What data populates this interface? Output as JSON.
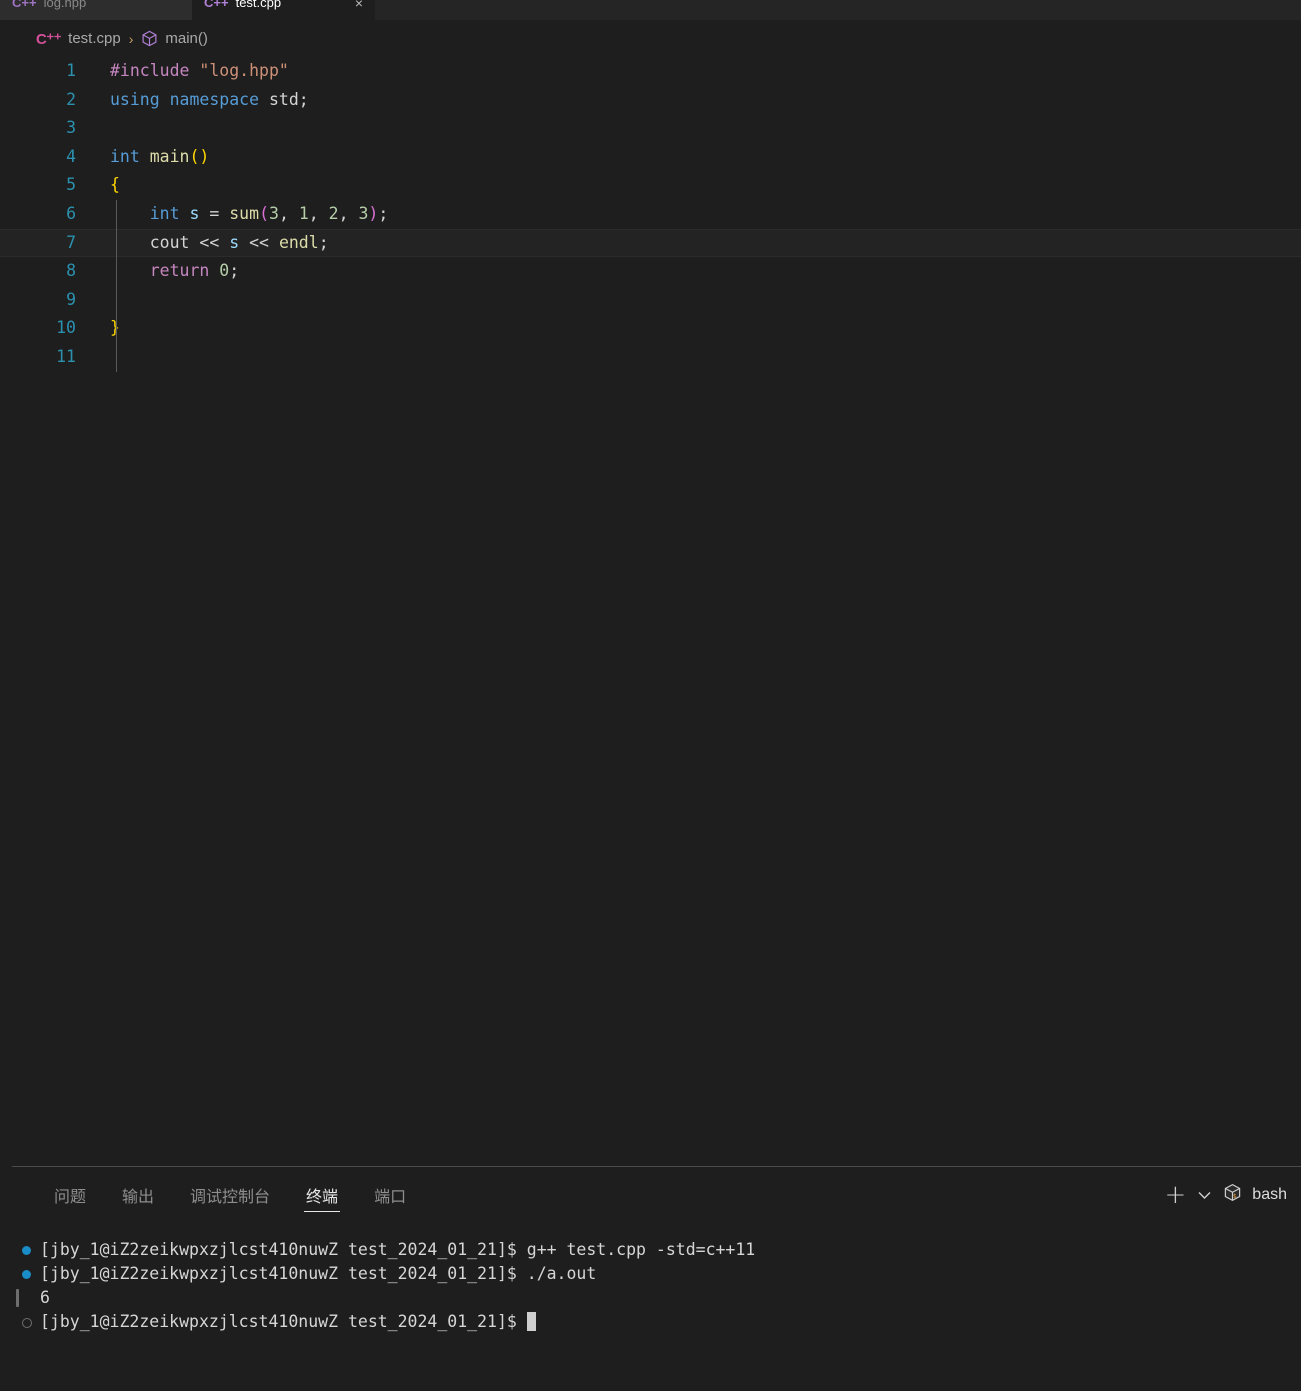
{
  "window": {
    "editor_background": "#1e1e1e",
    "tabbar_background": "#252526"
  },
  "tabbar": {
    "tabs": [
      {
        "label": "log.hpp",
        "icon": "cpp-header-file-icon",
        "icon_char": "C++",
        "active": false,
        "dirty": false
      },
      {
        "label": "test.cpp",
        "icon": "cpp-source-file-icon",
        "icon_char": "C++",
        "active": true,
        "close_char": "×"
      }
    ]
  },
  "breadcrumb": {
    "file_icon": "C⁺⁺",
    "file": "test.cpp",
    "separator": "›",
    "symbol_icon": "cube-icon",
    "symbol": "main()"
  },
  "editor": {
    "language": "cpp",
    "current_line": 7,
    "total_lines": 11,
    "lines": [
      {
        "n": "1",
        "tokens": [
          {
            "t": "#include ",
            "c": "t-pre"
          },
          {
            "t": "\"log.hpp\"",
            "c": "t-str"
          }
        ]
      },
      {
        "n": "2",
        "tokens": [
          {
            "t": "using",
            "c": "t-kw"
          },
          {
            "t": " ",
            "c": "t-plain"
          },
          {
            "t": "namespace",
            "c": "t-kw"
          },
          {
            "t": " ",
            "c": "t-plain"
          },
          {
            "t": "std",
            "c": "t-plain"
          },
          {
            "t": ";",
            "c": "t-plain"
          }
        ]
      },
      {
        "n": "3",
        "tokens": []
      },
      {
        "n": "4",
        "tokens": [
          {
            "t": "int",
            "c": "t-kw"
          },
          {
            "t": " ",
            "c": "t-plain"
          },
          {
            "t": "main",
            "c": "t-fn"
          },
          {
            "t": "()",
            "c": "t-brace"
          }
        ]
      },
      {
        "n": "5",
        "tokens": [
          {
            "t": "{",
            "c": "t-brace"
          }
        ]
      },
      {
        "n": "6",
        "tokens": [
          {
            "t": "    ",
            "c": "t-plain"
          },
          {
            "t": "int",
            "c": "t-kw"
          },
          {
            "t": " ",
            "c": "t-plain"
          },
          {
            "t": "s",
            "c": "t-var"
          },
          {
            "t": " = ",
            "c": "t-plain"
          },
          {
            "t": "sum",
            "c": "t-fn"
          },
          {
            "t": "(",
            "c": "t-paren"
          },
          {
            "t": "3",
            "c": "t-num"
          },
          {
            "t": ", ",
            "c": "t-plain"
          },
          {
            "t": "1",
            "c": "t-num"
          },
          {
            "t": ", ",
            "c": "t-plain"
          },
          {
            "t": "2",
            "c": "t-num"
          },
          {
            "t": ", ",
            "c": "t-plain"
          },
          {
            "t": "3",
            "c": "t-num"
          },
          {
            "t": ")",
            "c": "t-paren"
          },
          {
            "t": ";",
            "c": "t-plain"
          }
        ]
      },
      {
        "n": "7",
        "tokens": [
          {
            "t": "    ",
            "c": "t-plain"
          },
          {
            "t": "cout",
            "c": "t-plain"
          },
          {
            "t": " << ",
            "c": "t-plain"
          },
          {
            "t": "s",
            "c": "t-var"
          },
          {
            "t": " << ",
            "c": "t-plain"
          },
          {
            "t": "endl",
            "c": "t-fn"
          },
          {
            "t": ";",
            "c": "t-plain"
          }
        ]
      },
      {
        "n": "8",
        "tokens": [
          {
            "t": "    ",
            "c": "t-plain"
          },
          {
            "t": "return",
            "c": "t-kw2"
          },
          {
            "t": " ",
            "c": "t-plain"
          },
          {
            "t": "0",
            "c": "t-num"
          },
          {
            "t": ";",
            "c": "t-plain"
          }
        ]
      },
      {
        "n": "9",
        "tokens": []
      },
      {
        "n": "10",
        "tokens": [
          {
            "t": "}",
            "c": "t-brace"
          }
        ]
      },
      {
        "n": "11",
        "tokens": []
      }
    ]
  },
  "panel": {
    "tabs": [
      {
        "label": "问题",
        "name": "problems",
        "active": false
      },
      {
        "label": "输出",
        "name": "output",
        "active": false
      },
      {
        "label": "调试控制台",
        "name": "debug-console",
        "active": false
      },
      {
        "label": "终端",
        "name": "terminal",
        "active": true
      },
      {
        "label": "端口",
        "name": "ports",
        "active": false
      }
    ],
    "actions": {
      "new_terminal_icon": "plus-icon",
      "new_terminal_char": "+",
      "dropdown_icon": "chevron-down-icon",
      "dropdown_char": "⌄",
      "shell_icon": "terminal-cube-icon",
      "shell_label": "bash"
    }
  },
  "terminal": {
    "prompt": "[jby_1@iZ2zeikwpxzjlcst410nuwZ test_2024_01_21]$ ",
    "rows": [
      {
        "decoration": "command-success",
        "prompt": true,
        "text": "g++ test.cpp -std=c++11",
        "cursor": false
      },
      {
        "decoration": "command-success",
        "prompt": true,
        "text": "./a.out",
        "cursor": false
      },
      {
        "decoration": "output-bar",
        "prompt": false,
        "text": "6",
        "cursor": false
      },
      {
        "decoration": "command-idle",
        "prompt": true,
        "text": "",
        "cursor": true
      }
    ]
  }
}
